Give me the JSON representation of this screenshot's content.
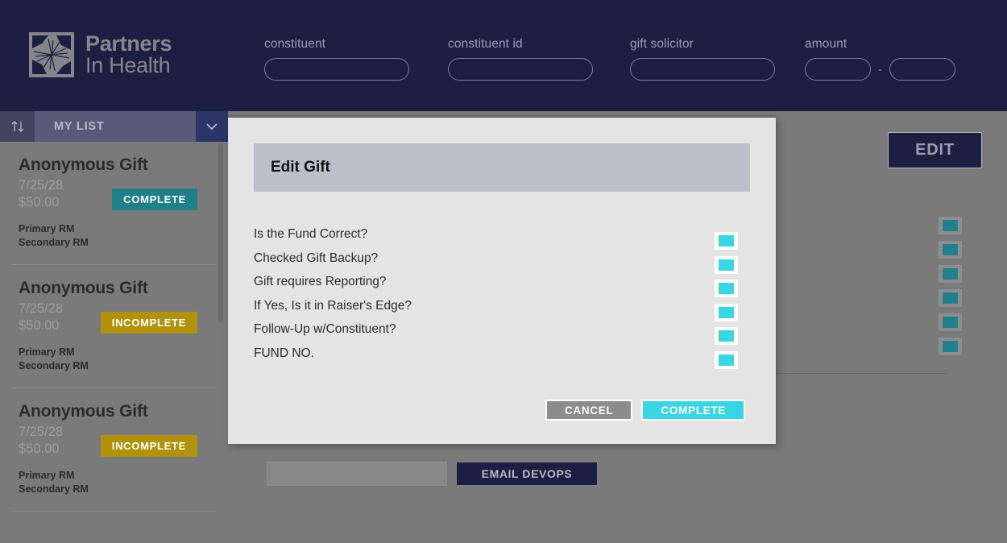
{
  "brand": {
    "line1": "Partners",
    "line2": "In Health",
    "logo_icon": "pinwheel-hands-logo",
    "bar_color": "#1d1f42",
    "logo_color": "#85868c"
  },
  "search": {
    "fields": [
      {
        "label": "constituent",
        "value": "",
        "placeholder": ""
      },
      {
        "label": "constituent id",
        "value": "",
        "placeholder": ""
      },
      {
        "label": "gift solicitor",
        "value": "",
        "placeholder": ""
      }
    ],
    "amount": {
      "label": "amount",
      "min_value": "",
      "max_value": "",
      "separator": "-"
    }
  },
  "sidebar": {
    "sort_icon": "sort-updown-icon",
    "title": "MY LIST",
    "dropdown_icon": "chevron-down-icon",
    "cards": [
      {
        "title": "Anonymous Gift",
        "date": "7/25/28",
        "amount": "$50.00",
        "status": "COMPLETE",
        "status_color": "#1f8089",
        "primary_rm": "Primary RM",
        "secondary_rm": "Secondary RM"
      },
      {
        "title": "Anonymous Gift",
        "date": "7/25/28",
        "amount": "$50.00",
        "status": "INCOMPLETE",
        "status_color": "#b0920b",
        "primary_rm": "Primary RM",
        "secondary_rm": "Secondary RM"
      },
      {
        "title": "Anonymous Gift",
        "date": "7/25/28",
        "amount": "$50.00",
        "status": "INCOMPLETE",
        "status_color": "#b0920b",
        "primary_rm": "Primary RM",
        "secondary_rm": "Secondary RM"
      }
    ]
  },
  "main": {
    "edit_label": "EDIT",
    "background_checkbox_count": 6,
    "devops": {
      "input_value": "",
      "button_label": "EMAIL DEVOPS"
    }
  },
  "modal": {
    "title": "Edit Gift",
    "title_bar_color": "#bfbfcc",
    "checkbox_color": "#3ad5e2",
    "rows": [
      {
        "label": "Is the Fund Correct?",
        "checked": true
      },
      {
        "label": "Checked Gift Backup?",
        "checked": true
      },
      {
        "label": "Gift requires Reporting?",
        "checked": true
      },
      {
        "label": "If Yes, Is it in Raiser's Edge?",
        "checked": true
      },
      {
        "label": "Follow-Up w/Constituent?",
        "checked": true
      },
      {
        "label": "FUND NO.",
        "checked": true
      }
    ],
    "cancel_label": "CANCEL",
    "complete_label": "COMPLETE"
  }
}
